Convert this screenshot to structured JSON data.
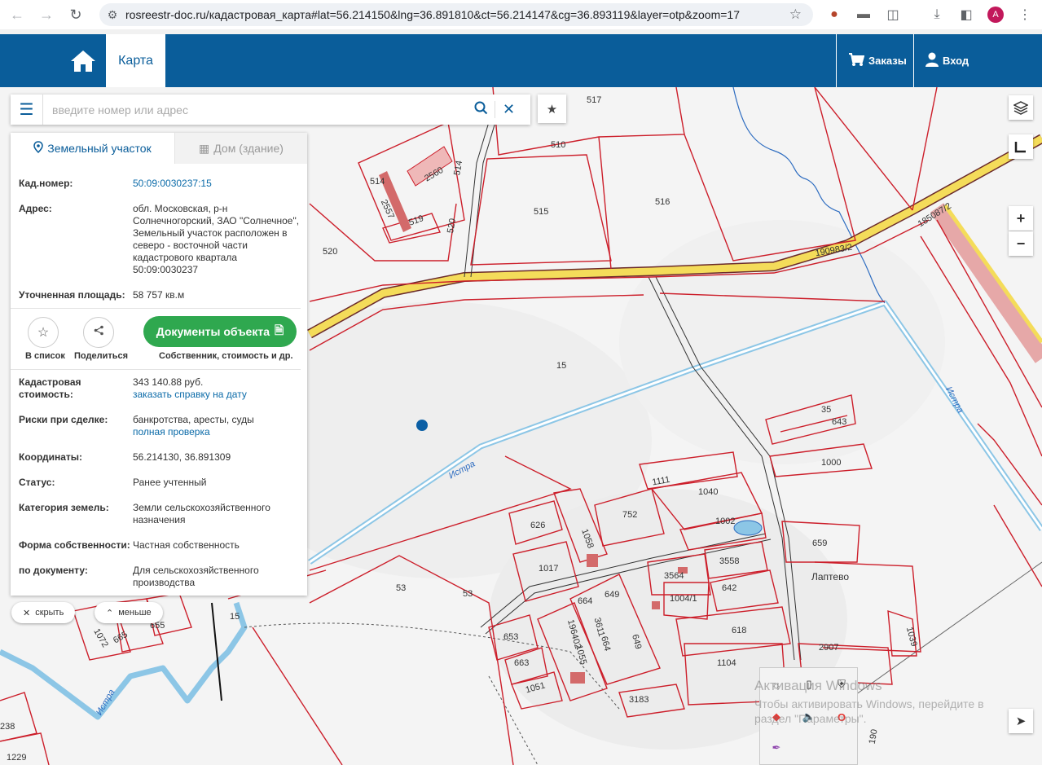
{
  "browser": {
    "url": "rosreestr-doc.ru/кадастровая_карта#lat=56.214150&lng=36.891810&ct=56.214147&cg=36.893119&layer=otp&zoom=17",
    "avatar_letter": "A"
  },
  "header": {
    "map_tab": "Карта",
    "orders_label": "Заказы",
    "login_label": "Вход",
    "brand_color": "#0a5d9a"
  },
  "search": {
    "placeholder": "введите номер или адрес"
  },
  "panel": {
    "tab_land": "Земельный участок",
    "tab_building": "Дом (здание)",
    "cad_number_label": "Кад.номер:",
    "cad_number": "50:09:0030237:15",
    "address_label": "Адрес:",
    "address": "обл. Московская, р-н Солнечногорский, ЗАО \"Солнечное\", Земельный участок расположен в северо - восточной части кадастрового квартала 50:09:0030237",
    "area_label": "Уточненная площадь:",
    "area": "58 757 кв.м",
    "to_list": "В список",
    "share": "Поделиться",
    "docs_button": "Документы объекта",
    "docs_sub": "Собственник, стоимость и др.",
    "cad_value_label": "Кадастровая стоимость:",
    "cad_value": "343 140.88 руб.",
    "cad_value_link": "заказать справку на дату",
    "risks_label": "Риски при сделке:",
    "risks": "банкротства, аресты, суды",
    "risks_link": "полная проверка",
    "coords_label": "Координаты:",
    "coords": "56.214130, 36.891309",
    "status_label": "Статус:",
    "status": "Ранее учтенный",
    "category_label": "Категория земель:",
    "category": "Земли сельскохозяйственного назначения",
    "ownership_label": "Форма собственности:",
    "ownership": "Частная собственность",
    "by_doc_label": "по документу:",
    "by_doc": "Для сельскохозяйственного производства",
    "hide": "скрыть",
    "less": "меньше"
  },
  "map": {
    "labels": {
      "p517": "517",
      "p510": "510",
      "p515": "515",
      "p516": "516",
      "p514a": "514",
      "p514b": "514",
      "p2560": "2560",
      "p2557": "2557",
      "p519": "519",
      "p520a": "520",
      "p520b": "520",
      "p190983": "190983/2",
      "p185087": "185087/2",
      "p15": "15",
      "p15b": "15",
      "p35": "35",
      "p643": "643",
      "p1000": "1000",
      "p1111": "1111",
      "p1040": "1040",
      "p752": "752",
      "p1002": "1002",
      "p626": "626",
      "p1058": "1058",
      "p659": "659",
      "p1017": "1017",
      "p3558": "3558",
      "p3564": "3564",
      "p642": "642",
      "p1004": "1004/1",
      "p664a": "664",
      "p649a": "649",
      "p664b": "664",
      "p649b": "649",
      "p3611": "3611",
      "p196402": "196402",
      "p1055": "1055",
      "p618": "618",
      "p653": "653",
      "p663": "663",
      "p1051": "1051",
      "p1104": "1104",
      "p3183": "3183",
      "p2907": "2907",
      "p1039": "1039",
      "p53a": "53",
      "p53b": "53",
      "p1072": "1072",
      "p665": "665",
      "p655": "655",
      "p238": "238",
      "p1229": "1229",
      "p190": "190",
      "laptevo": "Лаптево",
      "istra1": "Истра",
      "istra2": "Истра",
      "istra3": "Истра"
    },
    "parcel_color": "#cc1e2a",
    "road_color": "#f4dc5a",
    "river_color": "#8cc6e6",
    "marker_color": "#0b5fa5"
  },
  "watermark": {
    "title": "Активация Windows",
    "subtitle": "Чтобы активировать Windows, перейдите в раздел \"Параметры\"."
  }
}
